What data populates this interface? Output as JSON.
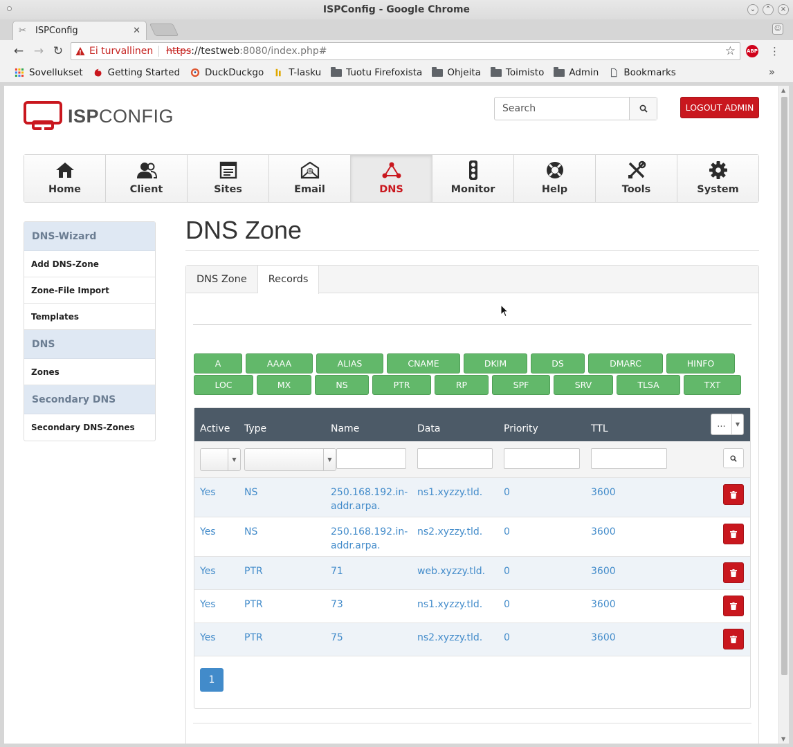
{
  "window": {
    "title": "ISPConfig - Google Chrome",
    "tab_title": "ISPConfig"
  },
  "address_bar": {
    "security_label": "Ei turvallinen",
    "scheme": "https",
    "host": "://testweb",
    "rest": ":8080/index.php#"
  },
  "bookmarks": [
    {
      "label": "Sovellukset",
      "icon": "apps-grid-icon"
    },
    {
      "label": "Getting Started",
      "icon": "firefox-icon"
    },
    {
      "label": "DuckDuckgo",
      "icon": "duckduckgo-icon"
    },
    {
      "label": "T-lasku",
      "icon": "tlasku-icon"
    },
    {
      "label": "Tuotu Firefoxista",
      "icon": "folder-icon"
    },
    {
      "label": "Ohjeita",
      "icon": "folder-icon"
    },
    {
      "label": "Toimisto",
      "icon": "folder-icon"
    },
    {
      "label": "Admin",
      "icon": "folder-icon"
    },
    {
      "label": "Bookmarks",
      "icon": "page-icon"
    }
  ],
  "header": {
    "logo_isp": "ISP",
    "logo_config": "CONFIG",
    "search_placeholder": "Search",
    "logout_label": "LOGOUT ADMIN"
  },
  "main_nav": [
    {
      "label": "Home",
      "icon": "home-icon"
    },
    {
      "label": "Client",
      "icon": "client-icon"
    },
    {
      "label": "Sites",
      "icon": "sites-icon"
    },
    {
      "label": "Email",
      "icon": "email-icon"
    },
    {
      "label": "DNS",
      "icon": "dns-icon",
      "active": true
    },
    {
      "label": "Monitor",
      "icon": "traffic-light-icon"
    },
    {
      "label": "Help",
      "icon": "lifebuoy-icon"
    },
    {
      "label": "Tools",
      "icon": "tools-icon"
    },
    {
      "label": "System",
      "icon": "gear-icon"
    }
  ],
  "sidebar": {
    "section1_title": "DNS-Wizard",
    "add_zone": "Add DNS-Zone",
    "zone_file_import": "Zone-File Import",
    "templates": "Templates",
    "section2_title": "DNS",
    "zones": "Zones",
    "section3_title": "Secondary DNS",
    "secondary_zones": "Secondary DNS-Zones"
  },
  "page": {
    "title": "DNS Zone",
    "tabs": [
      "DNS Zone",
      "Records"
    ],
    "active_tab": "Records"
  },
  "record_types": {
    "row1": [
      "A",
      "AAAA",
      "ALIAS",
      "CNAME",
      "DKIM",
      "DS",
      "DMARC",
      "HINFO"
    ],
    "row2": [
      "LOC",
      "MX",
      "NS",
      "PTR",
      "RP",
      "SPF",
      "SRV",
      "TLSA",
      "TXT"
    ]
  },
  "table": {
    "columns": [
      "Active",
      "Type",
      "Name",
      "Data",
      "Priority",
      "TTL"
    ],
    "column_menu_label": "...",
    "rows": [
      {
        "active": "Yes",
        "type": "NS",
        "name": "250.168.192.in-addr.arpa.",
        "data": "ns1.xyzzy.tld.",
        "priority": "0",
        "ttl": "3600"
      },
      {
        "active": "Yes",
        "type": "NS",
        "name": "250.168.192.in-addr.arpa.",
        "data": "ns2.xyzzy.tld.",
        "priority": "0",
        "ttl": "3600"
      },
      {
        "active": "Yes",
        "type": "PTR",
        "name": "71",
        "data": "web.xyzzy.tld.",
        "priority": "0",
        "ttl": "3600"
      },
      {
        "active": "Yes",
        "type": "PTR",
        "name": "73",
        "data": "ns1.xyzzy.tld.",
        "priority": "0",
        "ttl": "3600"
      },
      {
        "active": "Yes",
        "type": "PTR",
        "name": "75",
        "data": "ns2.xyzzy.tld.",
        "priority": "0",
        "ttl": "3600"
      }
    ],
    "current_page": "1"
  },
  "colors": {
    "brand_red": "#c9171e",
    "record_green": "#62b86a",
    "link_blue": "#428bca",
    "table_header": "#4c5a67"
  }
}
